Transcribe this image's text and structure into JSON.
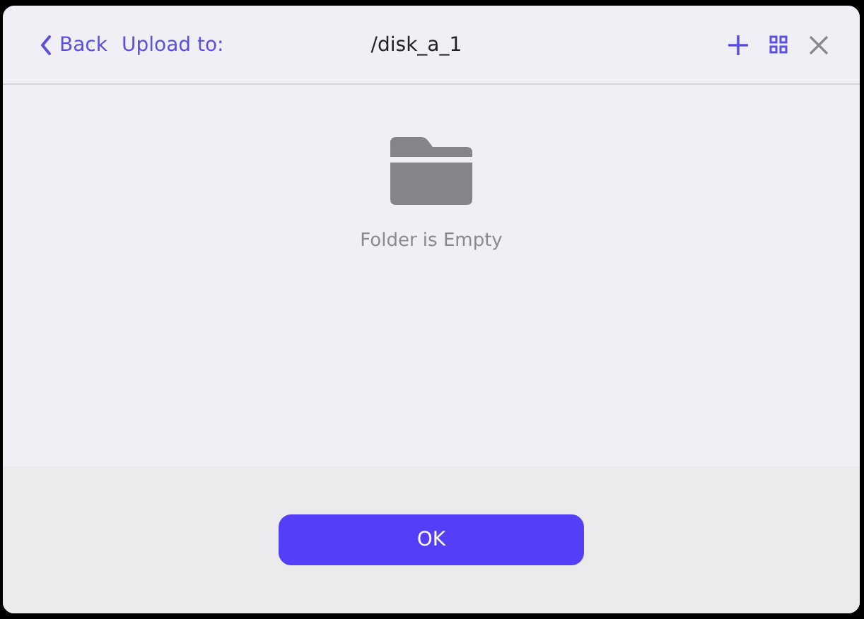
{
  "header": {
    "back": "Back",
    "upload_label": "Upload to:",
    "path": "/disk_a_1"
  },
  "empty_state": {
    "message": "Folder is Empty"
  },
  "buttons": [
    "OK"
  ]
}
